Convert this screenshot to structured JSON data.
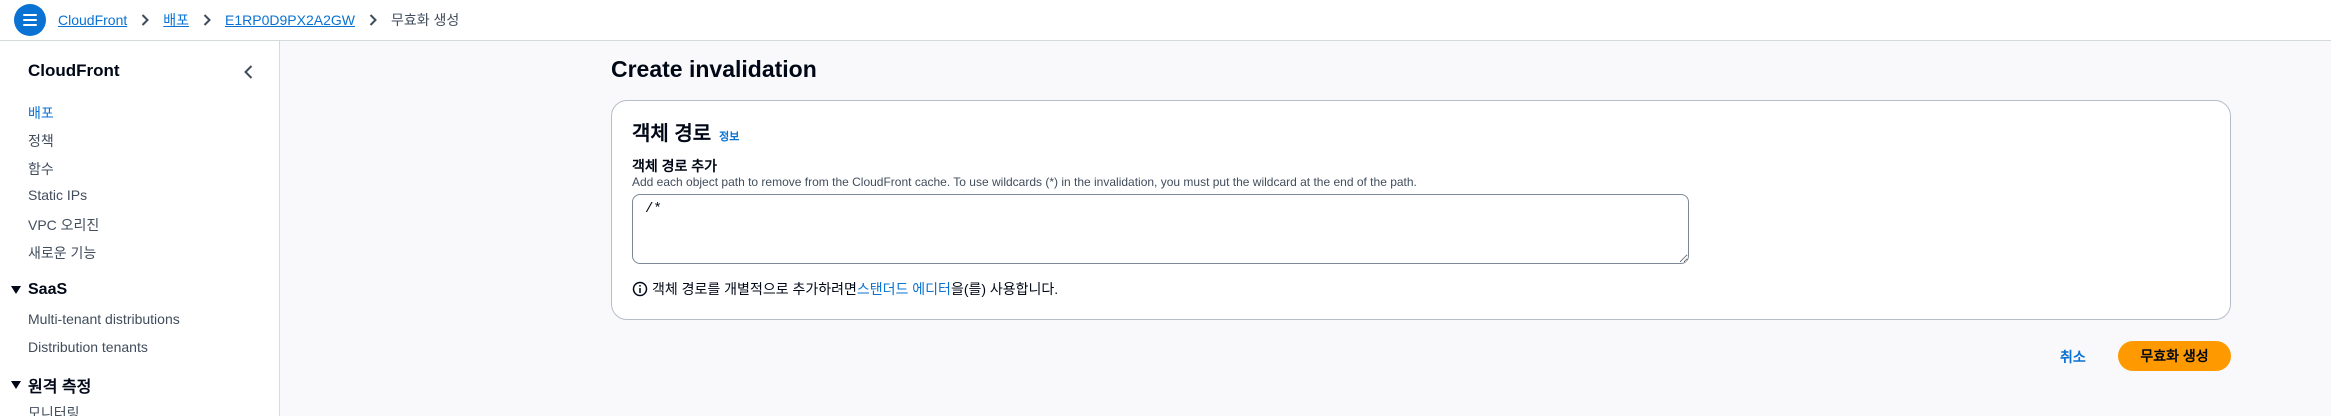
{
  "breadcrumb": {
    "items": [
      "CloudFront",
      "배포",
      "E1RP0D9PX2A2GW"
    ],
    "current": "무효화 생성"
  },
  "sidebar": {
    "title": "CloudFront",
    "items": [
      "배포",
      "정책",
      "함수",
      "Static IPs",
      "VPC 오리진",
      "새로운 기능"
    ],
    "active_item": "배포",
    "sections": [
      {
        "title": "SaaS",
        "items": [
          "Multi-tenant distributions",
          "Distribution tenants"
        ]
      },
      {
        "title": "원격 측정",
        "items": [
          "모니터링"
        ]
      }
    ]
  },
  "main": {
    "page_title": "Create invalidation",
    "panel": {
      "title": "객체 경로",
      "info": "정보",
      "field_label": "객체 경로 추가",
      "field_description": "Add each object path to remove from the CloudFront cache. To use wildcards (*) in the invalidation, you must put the wildcard at the end of the path.",
      "field_value": "/*",
      "hint_prefix": "객체 경로를 개별적으로 추가하려면 ",
      "hint_link": "스탠더드 에디터",
      "hint_suffix": "을(를) 사용합니다."
    },
    "actions": {
      "cancel": "취소",
      "submit": "무효화 생성"
    }
  },
  "colors": {
    "accent": "#0972d3",
    "primary_button": "#ff9900"
  },
  "icons": [
    "menu-icon",
    "chevron-right-icon",
    "chevron-left-icon",
    "caret-down-icon",
    "info-circle-icon"
  ]
}
